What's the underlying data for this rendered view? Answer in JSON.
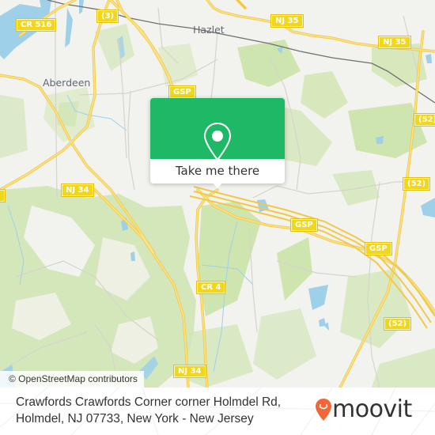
{
  "map": {
    "colors": {
      "land": "#f2f2ee",
      "park": "#cfe5b0",
      "park_light": "#dcebc6",
      "water": "#9fd0ea",
      "road_major": "#f6d65a",
      "road_minor": "#d6d3cc",
      "rail": "#707070"
    },
    "places": [
      {
        "name": "Hazlet"
      },
      {
        "name": "Aberdeen"
      }
    ],
    "shields": [
      {
        "label": "CR 516"
      },
      {
        "label": "(3)"
      },
      {
        "label": "NJ 35"
      },
      {
        "label": "NJ 35"
      },
      {
        "label": "GSP"
      },
      {
        "label": "(52)"
      },
      {
        "label": "(52)"
      },
      {
        "label": "NJ 34"
      },
      {
        "label": "GSP"
      },
      {
        "label": "GSP"
      },
      {
        "label": "CR 4"
      },
      {
        "label": "(52)"
      },
      {
        "label": "NJ 34"
      }
    ],
    "attribution": "© OpenStreetMap contributors"
  },
  "popup": {
    "icon": "map-pin-icon",
    "button_label": "Take me there",
    "accent": "#1fb866"
  },
  "footer": {
    "address_line1": "Crawfords Crawfords Corner corner Holmdel Rd,",
    "address_line2": "Holmdel, NJ 07733, New York - New Jersey",
    "brand": "moovit",
    "brand_icon": "moovit-pin-logo-icon",
    "brand_color": "#f2673a"
  }
}
